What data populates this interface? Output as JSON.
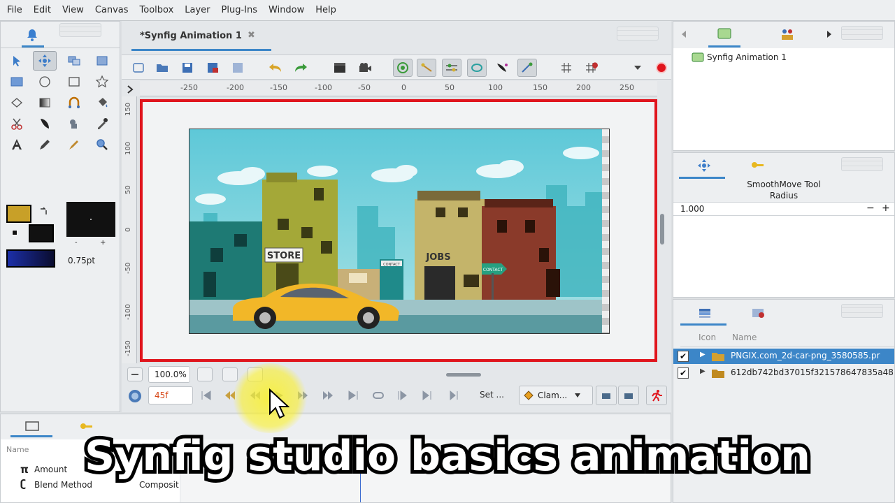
{
  "menubar": {
    "items": [
      "File",
      "Edit",
      "View",
      "Canvas",
      "Toolbox",
      "Layer",
      "Plug-Ins",
      "Window",
      "Help"
    ]
  },
  "document": {
    "tab_title": "*Synfig Animation 1",
    "close_glyph": "✖"
  },
  "ruler": {
    "h_ticks": [
      "-250",
      "-200",
      "-150",
      "-100",
      "-50",
      "0",
      "50",
      "100",
      "150",
      "200",
      "250"
    ],
    "v_ticks": [
      "150",
      "100",
      "50",
      "0",
      "-50",
      "-100",
      "-150"
    ]
  },
  "scene": {
    "store_sign": "STORE",
    "jobs_sign": "JOBS",
    "small_sign": "CONTACT",
    "poster_sign": "CONTACT"
  },
  "toolbox": {
    "brush_size": "0.75pt",
    "outline_color": "#c8a028",
    "fill_color": "#111111",
    "minus": "-",
    "plus": "+"
  },
  "statusbar": {
    "zoom": "100.0%",
    "frame": "45f",
    "set_label": "Set ...",
    "interp_label": "Clam..."
  },
  "canvas_browser": {
    "item": "Synfig Animation 1"
  },
  "tool_options": {
    "title": "SmoothMove Tool",
    "radius_label": "Radius",
    "radius_value": "1.000",
    "minus": "−",
    "plus": "+"
  },
  "layers": {
    "columns": [
      "Icon",
      "Name"
    ],
    "rows": [
      {
        "name": "PNGIX.com_2d-car-png_3580585.pr",
        "selected": true
      },
      {
        "name": "612db742bd37015f321578647835a48",
        "selected": false
      }
    ]
  },
  "params": {
    "header": "Name",
    "rows": [
      {
        "symbol": "π",
        "label": "Amount"
      },
      {
        "symbol": "ʗ",
        "label": "Blend Method",
        "value": "Composit"
      }
    ]
  },
  "caption": "Synfig studio basics animation",
  "colors": {
    "accent": "#3c86c8",
    "frame_border": "#e0151d",
    "record": "#e0151d"
  }
}
